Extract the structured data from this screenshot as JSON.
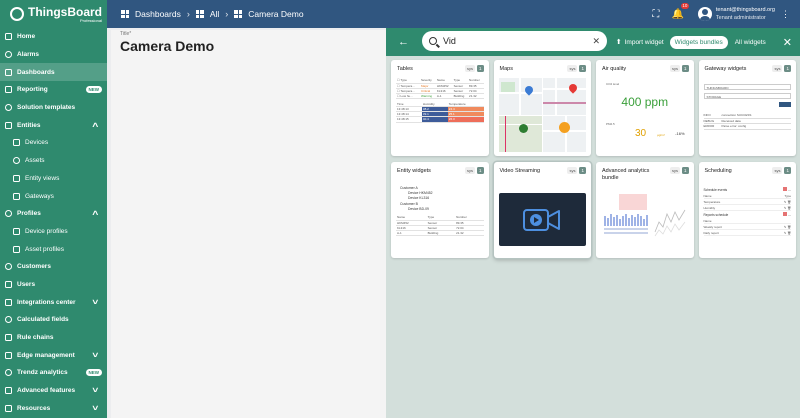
{
  "app": {
    "logo_name": "ThingsBoard",
    "logo_sub": "Professional"
  },
  "breadcrumb": [
    "Dashboards",
    "All",
    "Camera Demo"
  ],
  "user": {
    "email": "tenant@thingsboard.org",
    "role": "Tenant administrator",
    "notification_count": "10"
  },
  "sidebar": {
    "items": [
      {
        "label": "Home",
        "icon": "home-icon"
      },
      {
        "label": "Alarms",
        "icon": "alarm-icon"
      },
      {
        "label": "Dashboards",
        "icon": "dashboards-icon",
        "active": true
      },
      {
        "label": "Reporting",
        "icon": "reporting-icon",
        "badge": "NEW"
      },
      {
        "label": "Solution templates",
        "icon": "templates-icon"
      },
      {
        "label": "Entities",
        "icon": "entities-icon",
        "expanded": true
      },
      {
        "label": "Devices",
        "icon": "devices-icon",
        "sub": true
      },
      {
        "label": "Assets",
        "icon": "assets-icon",
        "sub": true
      },
      {
        "label": "Entity views",
        "icon": "entity-views-icon",
        "sub": true
      },
      {
        "label": "Gateways",
        "icon": "gateways-icon",
        "sub": true
      },
      {
        "label": "Profiles",
        "icon": "profiles-icon",
        "expanded": true
      },
      {
        "label": "Device profiles",
        "icon": "device-profiles-icon",
        "sub": true
      },
      {
        "label": "Asset profiles",
        "icon": "asset-profiles-icon",
        "sub": true
      },
      {
        "label": "Customers",
        "icon": "customers-icon"
      },
      {
        "label": "Users",
        "icon": "users-icon"
      },
      {
        "label": "Integrations center",
        "icon": "integrations-icon",
        "collapsed": true
      },
      {
        "label": "Calculated fields",
        "icon": "calculated-fields-icon"
      },
      {
        "label": "Rule chains",
        "icon": "rule-chains-icon"
      },
      {
        "label": "Edge management",
        "icon": "edge-icon",
        "collapsed": true
      },
      {
        "label": "Trendz analytics",
        "icon": "trendz-icon",
        "badge": "NEW"
      },
      {
        "label": "Advanced features",
        "icon": "advanced-icon",
        "collapsed": true
      },
      {
        "label": "Resources",
        "icon": "resources-icon",
        "collapsed": true
      }
    ]
  },
  "dashboard": {
    "title_label": "Title*",
    "title": "Camera Demo"
  },
  "widgets_panel": {
    "search_value": "Vid",
    "import_label": "Import widget",
    "toggle_bundles": "Widgets bundles",
    "toggle_all": "All widgets",
    "cards": [
      {
        "title": "Tables",
        "sys": "sys",
        "count": "1"
      },
      {
        "title": "Maps",
        "sys": "sys",
        "count": "1"
      },
      {
        "title": "Air quality",
        "sys": "sys",
        "count": "1"
      },
      {
        "title": "Gateway widgets",
        "sys": "sys",
        "count": "1"
      },
      {
        "title": "Entity widgets",
        "sys": "sys",
        "count": "1"
      },
      {
        "title": "Video Streaming",
        "sys": "sys",
        "count": "1"
      },
      {
        "title": "Advanced analytics bundle",
        "sys": "sys",
        "count": "1"
      },
      {
        "title": "Scheduling",
        "sys": "sys",
        "count": "1"
      }
    ],
    "air_quality": {
      "co2_label": "CO2 level",
      "co2_value": "400 ppm",
      "pm_label": "PM2.5",
      "pm_value": "30",
      "pm_unit": "µg/m³",
      "pm_change": "-16%"
    },
    "gateway": {
      "select1": "THINGSBOARD",
      "select2": "STORAGE",
      "rows": [
        [
          "INFO",
          "connection SUCCESS"
        ],
        [
          "DEBUG",
          "Received data"
        ],
        [
          "ERROR",
          "Parse error: config"
        ]
      ]
    },
    "entity_tree": [
      "Customer A",
      "Device HKM452",
      "Device KL316",
      "Customer B",
      "Device BD-09"
    ],
    "entity_table": [
      [
        "Name",
        "Type",
        "Number"
      ],
      [
        "HKM452",
        "Sensor",
        "89.35"
      ],
      [
        "KL316",
        "Sensor",
        "72.04"
      ],
      [
        "A-1",
        "Building",
        "21.32"
      ]
    ],
    "scheduling": {
      "title1": "Schedule events",
      "title2": "Reports schedule",
      "rows1": [
        "Name",
        "Temperature",
        "Humidity"
      ],
      "rows2": [
        "Name",
        "Weekly report",
        "Daily report"
      ]
    }
  },
  "colors": {
    "sidebar": "#2f8a6e",
    "topbar": "#305680",
    "accent": "#2f8a6e",
    "notification": "#e53935"
  }
}
